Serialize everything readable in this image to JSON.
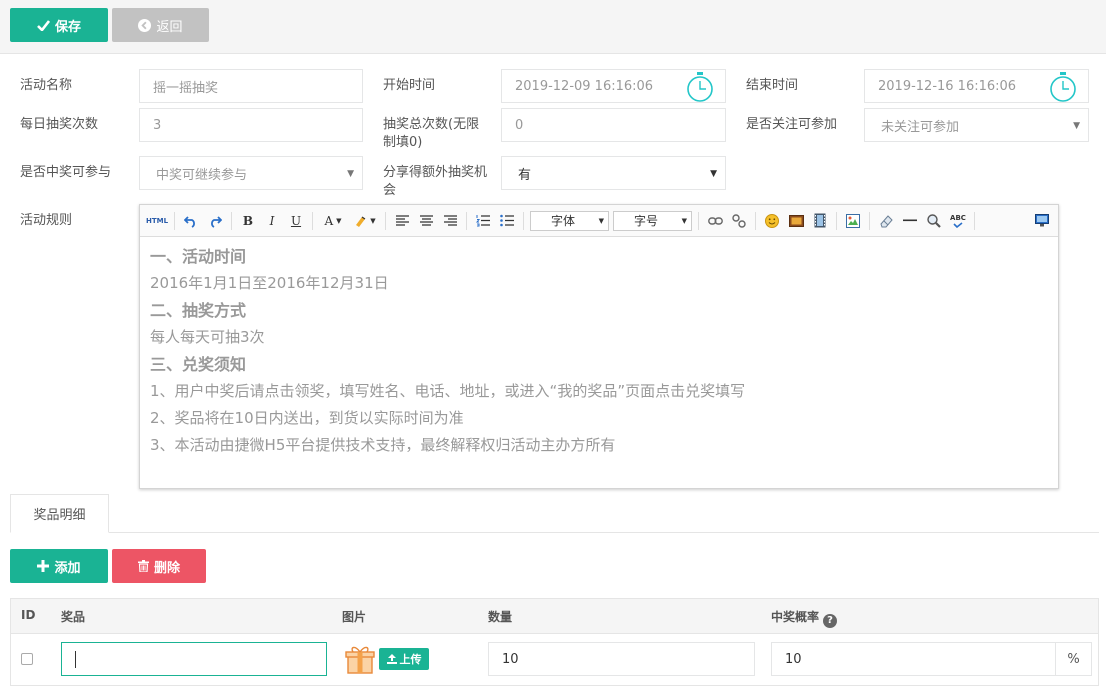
{
  "toolbar": {
    "save_label": "保存",
    "back_label": "返回"
  },
  "form": {
    "activity_name": {
      "label": "活动名称",
      "placeholder": "摇一摇抽奖"
    },
    "start_time": {
      "label": "开始时间",
      "value": "2019-12-09 16:16:06"
    },
    "end_time": {
      "label": "结束时间",
      "value": "2019-12-16 16:16:06"
    },
    "daily_draws": {
      "label": "每日抽奖次数",
      "value": "3"
    },
    "total_draws": {
      "label_line1": "抽奖总次数(无限",
      "label_line2": "制填0)",
      "value": "0"
    },
    "follow_required": {
      "label": "是否关注可参加",
      "value": "未关注可参加"
    },
    "winner_can_join": {
      "label": "是否中奖可参与",
      "value": "中奖可继续参与"
    },
    "share_bonus": {
      "label_line1": "分享得额外抽奖机",
      "label_line2": "会",
      "value": "有"
    },
    "rules": {
      "label": "活动规则"
    }
  },
  "editor": {
    "toolbar": {
      "html": "HTML",
      "bold": "B",
      "italic": "I",
      "underline": "U",
      "font_color": "A",
      "font_label": "字体",
      "size_label": "字号",
      "spell": "ABC"
    },
    "content": {
      "h1": "一、活动时间",
      "p1": "2016年1月1日至2016年12月31日",
      "h2": "二、抽奖方式",
      "p2": "每人每天可抽3次",
      "h3": "三、兑奖须知",
      "p3": "1、用户中奖后请点击领奖，填写姓名、电话、地址，或进入“我的奖品”页面点击兑奖填写",
      "p4": "2、奖品将在10日内送出，到货以实际时间为准",
      "p5": "3、本活动由捷微H5平台提供技术支持，最终解释权归活动主办方所有"
    }
  },
  "prize_tab": {
    "label": "奖品明细"
  },
  "prize_actions": {
    "add_label": "添加",
    "delete_label": "删除"
  },
  "prize_table": {
    "headers": {
      "id": "ID",
      "prize": "奖品",
      "image": "图片",
      "quantity": "数量",
      "probability": "中奖概率"
    },
    "help_glyph": "?",
    "rows": [
      {
        "prize": "",
        "upload_label": "上传",
        "quantity": "10",
        "probability": "10",
        "unit": "%"
      }
    ]
  },
  "colors": {
    "primary": "#1ab394",
    "danger": "#ed5565",
    "muted": "#c2c2c2",
    "clock": "#23c6c8"
  }
}
